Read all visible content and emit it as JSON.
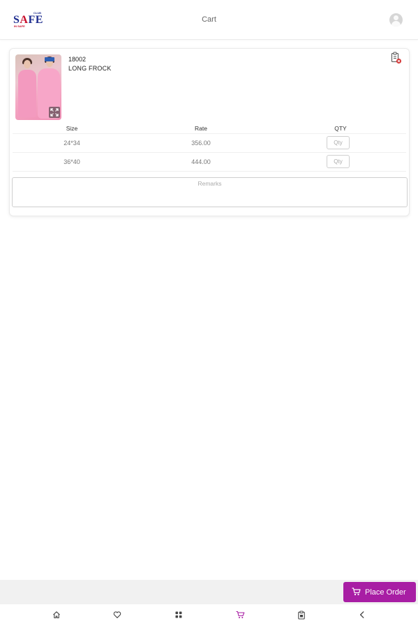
{
  "header": {
    "title": "Cart",
    "logo": {
      "text_main_1": "S",
      "text_main_2": "A",
      "text_main_3": "FE",
      "small_top": "CLUB",
      "small_bottom": "IN SAFE"
    }
  },
  "cart": {
    "items": [
      {
        "code": "18002",
        "name": "LONG FROCK",
        "table": {
          "headers": {
            "size": "Size",
            "rate": "Rate",
            "qty": "QTY"
          },
          "rows": [
            {
              "size": "24*34",
              "rate": "356.00",
              "qty_placeholder": "Qty",
              "qty_value": ""
            },
            {
              "size": "36*40",
              "rate": "444.00",
              "qty_placeholder": "Qty",
              "qty_value": ""
            }
          ]
        },
        "remarks_placeholder": "Remarks"
      }
    ]
  },
  "footer": {
    "place_order_label": "Place Order"
  },
  "bottom_nav": {
    "items": [
      {
        "name": "home",
        "icon": "home-icon"
      },
      {
        "name": "wishlist",
        "icon": "heart-icon"
      },
      {
        "name": "categories",
        "icon": "grid-icon"
      },
      {
        "name": "cart",
        "icon": "cart-icon",
        "active": true
      },
      {
        "name": "orders",
        "icon": "clipboard-icon"
      },
      {
        "name": "back",
        "icon": "chevron-left-icon"
      }
    ]
  },
  "colors": {
    "accent": "#a81ea4",
    "delete_icon": "#d32f2f",
    "logo_blue": "#1e2d8f",
    "logo_red": "#c8102e"
  }
}
